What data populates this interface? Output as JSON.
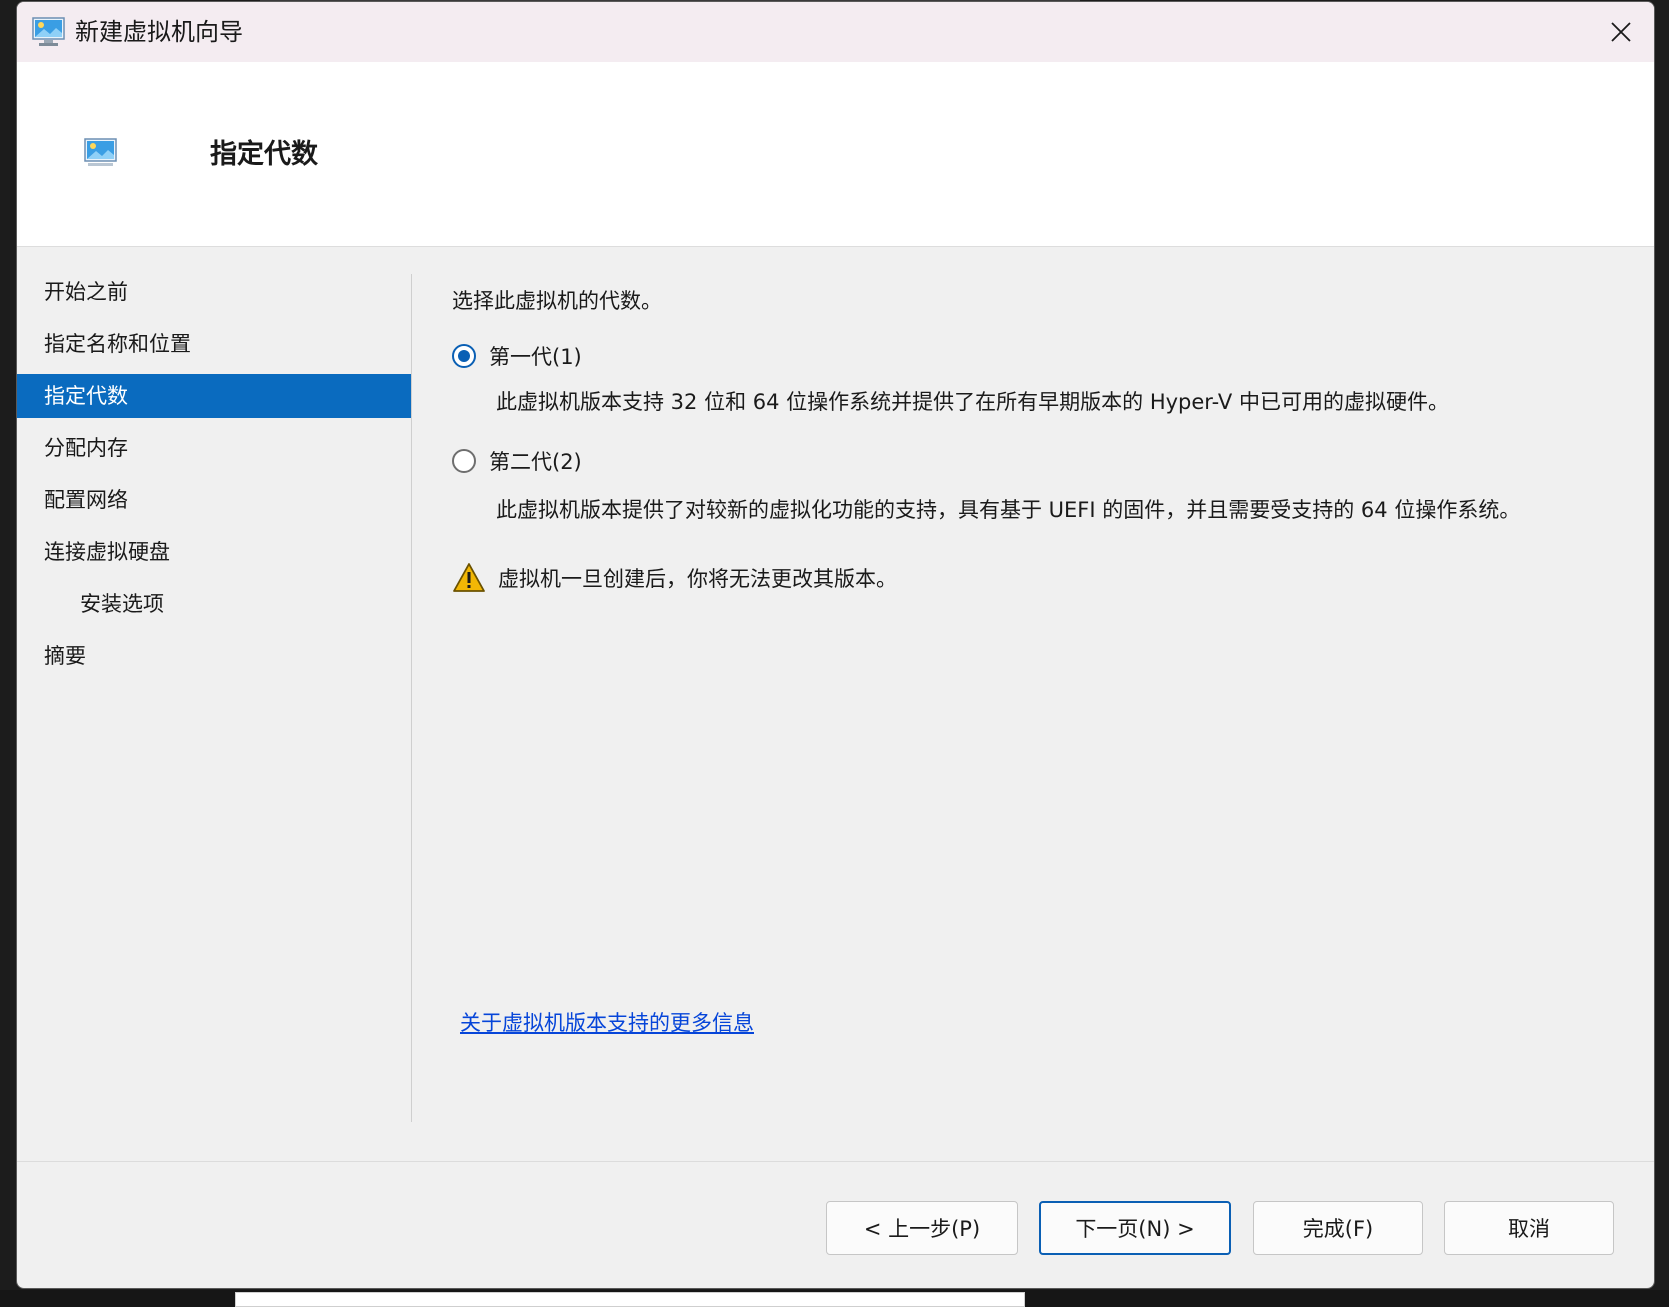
{
  "window": {
    "title": "新建虚拟机向导",
    "close_glyph": "✕"
  },
  "header": {
    "title": "指定代数"
  },
  "nav": {
    "items": [
      {
        "label": "开始之前"
      },
      {
        "label": "指定名称和位置"
      },
      {
        "label": "指定代数",
        "active": true
      },
      {
        "label": "分配内存"
      },
      {
        "label": "配置网络"
      },
      {
        "label": "连接虚拟硬盘"
      },
      {
        "label": "安装选项",
        "sub": true
      },
      {
        "label": "摘要"
      }
    ]
  },
  "content": {
    "prompt": "选择此虚拟机的代数。",
    "options": [
      {
        "label": "第一代(1)",
        "checked": true,
        "description": "此虚拟机版本支持 32 位和 64 位操作系统并提供了在所有早期版本的 Hyper-V 中已可用的虚拟硬件。"
      },
      {
        "label": "第二代(2)",
        "checked": false,
        "description": "此虚拟机版本提供了对较新的虚拟化功能的支持，具有基于 UEFI 的固件，并且需要受支持的 64 位操作系统。"
      }
    ],
    "warning": "虚拟机一旦创建后，你将无法更改其版本。",
    "more_info_link": "关于虚拟机版本支持的更多信息"
  },
  "footer": {
    "back_label": "< 上一步(P)",
    "next_label": "下一页(N) >",
    "finish_label": "完成(F)",
    "cancel_label": "取消"
  },
  "colors": {
    "accent": "#0a6bbf",
    "link": "#0645d9",
    "warning": "#f2b705"
  },
  "icons": {
    "title": "vm-monitor-icon",
    "header": "vm-monitor-icon",
    "close": "close-icon",
    "warning": "warning-icon"
  }
}
